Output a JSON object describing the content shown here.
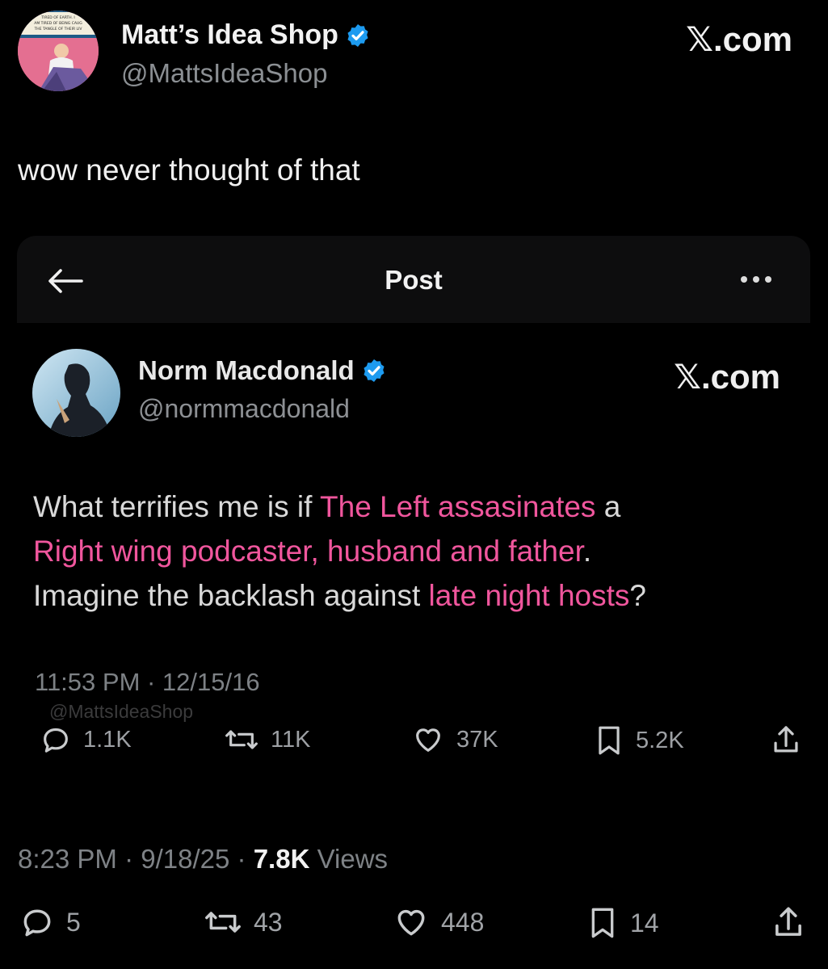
{
  "outer": {
    "display_name": "Matt’s Idea Shop",
    "handle": "@MattsIdeaShop",
    "brand": "𝕏.com",
    "text": "wow never thought of that",
    "avatar_caption_lines": [
      "TIRED OF EARTH. I",
      "AM TIRED OF BEING CAUG",
      "THE TANGLE OF THEIR LIV"
    ],
    "timestamp_time": "8:23 PM",
    "timestamp_date": "9/18/25",
    "views_count": "7.8K",
    "views_label": "Views",
    "sep": "·",
    "actions": {
      "replies": "5",
      "reposts": "43",
      "likes": "448",
      "bookmarks": "14"
    }
  },
  "embedded": {
    "topbar_title": "Post",
    "display_name": "Norm Macdonald",
    "handle": "@normmacdonald",
    "brand": "𝕏.com",
    "text": {
      "p1": "What terrifies me is if ",
      "h1": "The Left assasinates",
      "p2": " a",
      "h2": "Right wing podcaster, husband and father",
      "p3": ".",
      "p4": "Imagine the backlash against ",
      "h3": "late night hosts",
      "p5": "?"
    },
    "timestamp": "11:53 PM · 12/15/16",
    "watermark": "@MattsIdeaShop",
    "actions": {
      "replies": "1.1K",
      "reposts": "11K",
      "likes": "37K",
      "bookmarks": "5.2K"
    }
  },
  "colors": {
    "verified": "#1d9bf0",
    "highlight": "#f0569d",
    "background": "#000000"
  }
}
